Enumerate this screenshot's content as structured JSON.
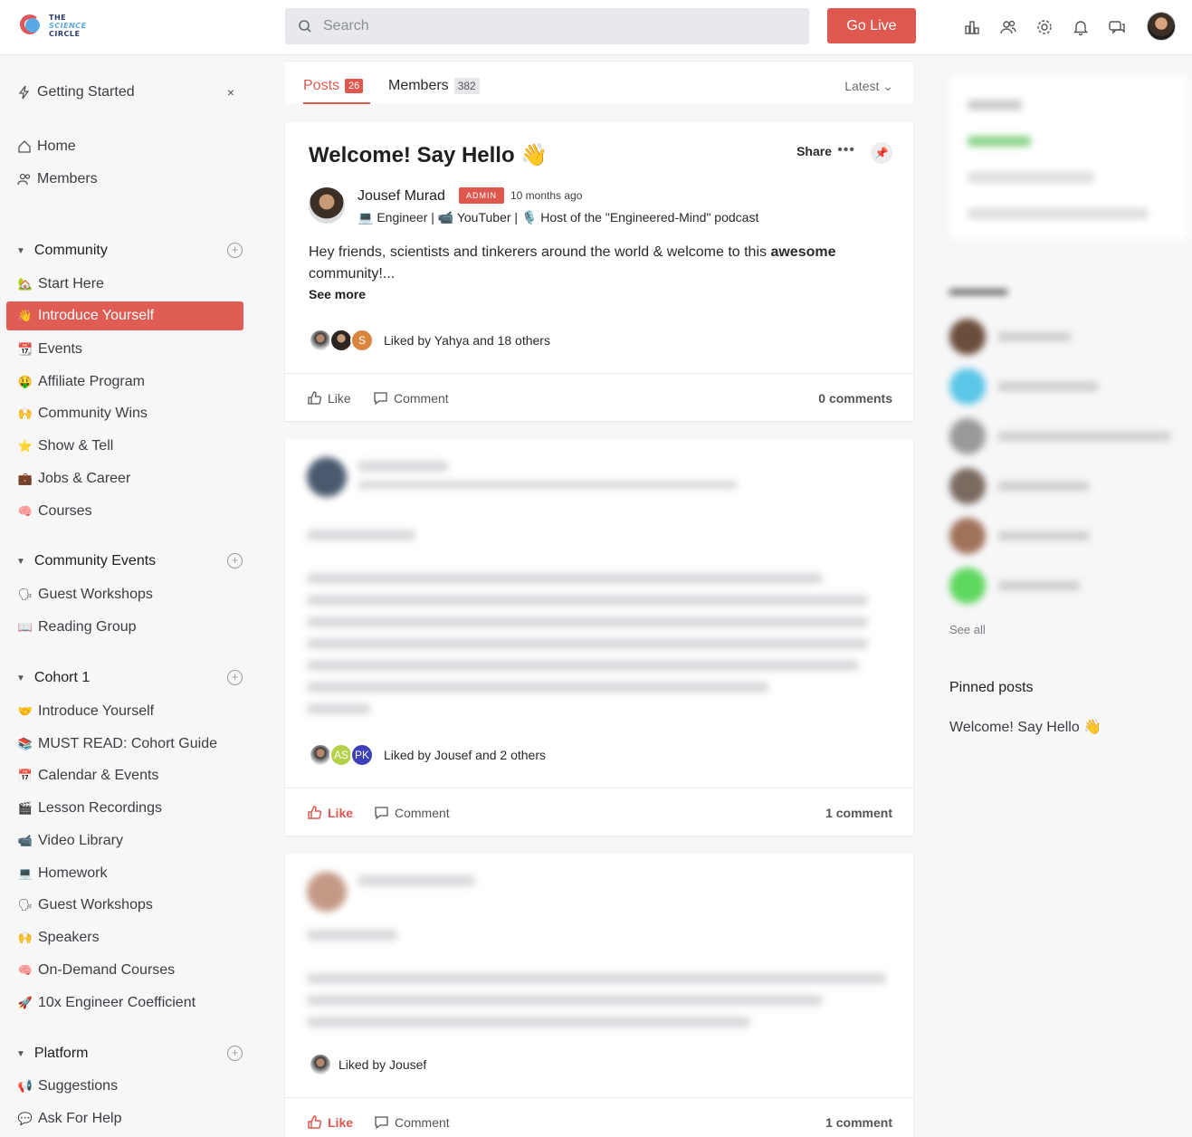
{
  "header": {
    "logo_lines": [
      "THE",
      "SCIENCE",
      "CIRCLE"
    ],
    "search_placeholder": "Search",
    "go_live_label": "Go Live",
    "icons": [
      "leaderboard-icon",
      "members-icon",
      "settings-icon",
      "notifications-icon",
      "messages-icon"
    ]
  },
  "sidebar": {
    "getting_started": "Getting Started",
    "close_glyph": "×",
    "home": "Home",
    "members": "Members",
    "sections": [
      {
        "title": "Community",
        "items": [
          {
            "emoji": "🏡",
            "label": "Start Here"
          },
          {
            "emoji": "👋",
            "label": "Introduce Yourself",
            "active": true
          },
          {
            "emoji": "📆",
            "label": "Events"
          },
          {
            "emoji": "🤑",
            "label": "Affiliate Program"
          },
          {
            "emoji": "🙌",
            "label": "Community Wins"
          },
          {
            "emoji": "⭐",
            "label": "Show & Tell"
          },
          {
            "emoji": "💼",
            "label": "Jobs & Career"
          },
          {
            "emoji": "🧠",
            "label": "Courses"
          }
        ]
      },
      {
        "title": "Community Events",
        "items": [
          {
            "emoji": "🗣",
            "label": "Guest Workshops"
          },
          {
            "emoji": "📖",
            "label": "Reading Group"
          }
        ]
      },
      {
        "title": "Cohort 1",
        "items": [
          {
            "emoji": "🤝",
            "label": "Introduce Yourself"
          },
          {
            "emoji": "📚",
            "label": "MUST READ: Cohort Guide"
          },
          {
            "emoji": "📅",
            "label": "Calendar & Events"
          },
          {
            "emoji": "🎬",
            "label": "Lesson Recordings"
          },
          {
            "emoji": "📹",
            "label": "Video Library"
          },
          {
            "emoji": "💻",
            "label": "Homework"
          },
          {
            "emoji": "🗣",
            "label": "Guest Workshops"
          },
          {
            "emoji": "🙌",
            "label": "Speakers"
          },
          {
            "emoji": "🧠",
            "label": "On-Demand Courses"
          },
          {
            "emoji": "🚀",
            "label": "10x Engineer Coefficient"
          }
        ]
      },
      {
        "title": "Platform",
        "items": [
          {
            "emoji": "📢",
            "label": "Suggestions"
          },
          {
            "emoji": "💬",
            "label": "Ask For Help"
          }
        ]
      }
    ]
  },
  "feed": {
    "tabs": {
      "posts_label": "Posts",
      "posts_count": "26",
      "members_label": "Members",
      "members_count": "382",
      "sort_label": "Latest"
    },
    "post1": {
      "title": "Welcome! Say Hello 👋",
      "share": "Share",
      "dots": "•••",
      "author": "Jousef Murad",
      "role_badge": "ADMIN",
      "time": "10 months ago",
      "bio": "💻 Engineer | 📹 YouTuber | 🎙️ Host of the \"Engineered-Mind\" podcast",
      "body_prefix": "Hey friends, scientists and tinkerers around the world & welcome to this ",
      "body_bold": "awesome",
      "body_suffix": " community!...",
      "see_more": "See more",
      "liker_initial": "S",
      "liked_by": "Liked by Yahya and 18 others",
      "like": "Like",
      "comment": "Comment",
      "comments_count": "0 comments"
    },
    "post2": {
      "liker_initials": [
        "AS",
        "PK"
      ],
      "liked_by": "Liked by Jousef and 2 others",
      "like": "Like",
      "comment": "Comment",
      "comments_count": "1 comment"
    },
    "post3": {
      "liked_by": "Liked by Jousef",
      "like": "Like",
      "comment": "Comment",
      "comments_count": "1 comment"
    }
  },
  "right": {
    "see_all": "See all",
    "pinned_title": "Pinned posts",
    "pinned_link": "Welcome! Say Hello 👋"
  },
  "colors": {
    "accent": "#de5850",
    "sidebar_bg": "#f7f7f8"
  }
}
